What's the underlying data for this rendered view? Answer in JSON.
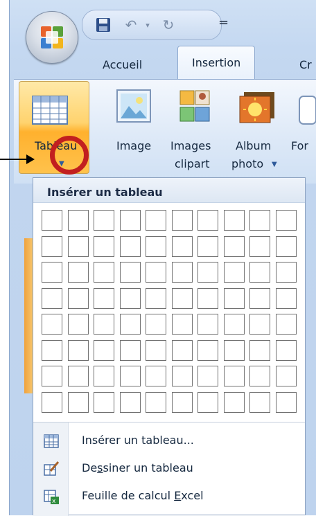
{
  "quick_access": {
    "save_icon": "save-icon",
    "undo_icon": "undo-icon",
    "redo_icon": "redo-icon",
    "customize_icon": "customize-qat-icon"
  },
  "tabs": [
    {
      "label": "Accueil"
    },
    {
      "label": "Insertion",
      "active": true
    },
    {
      "label": "Cr"
    }
  ],
  "ribbon": {
    "tableau": {
      "label_a": "Tab",
      "label_b": "leau"
    },
    "image": {
      "label": "Image"
    },
    "images_clipart": {
      "line1": "Images",
      "line2": "clipart"
    },
    "album_photo": {
      "line1": "Album",
      "line2": "photo"
    },
    "formes": {
      "label": "For"
    }
  },
  "menu": {
    "header": "Insérer un tableau",
    "grid": {
      "rows": 8,
      "cols": 10
    },
    "items": [
      {
        "pre": "Insérer un tableau...",
        "u": "",
        "post": "",
        "icon": "insert-table-icon"
      },
      {
        "pre": "De",
        "u": "s",
        "post": "siner un tableau",
        "icon": "draw-table-icon"
      },
      {
        "pre": "Feuille de calcul ",
        "u": "E",
        "post": "xcel",
        "icon": "excel-sheet-icon"
      }
    ]
  },
  "colors": {
    "highlight_circle": "#c21f1f",
    "active_button": "#ffc24c",
    "ribbon_bg": "#dce8f7"
  }
}
